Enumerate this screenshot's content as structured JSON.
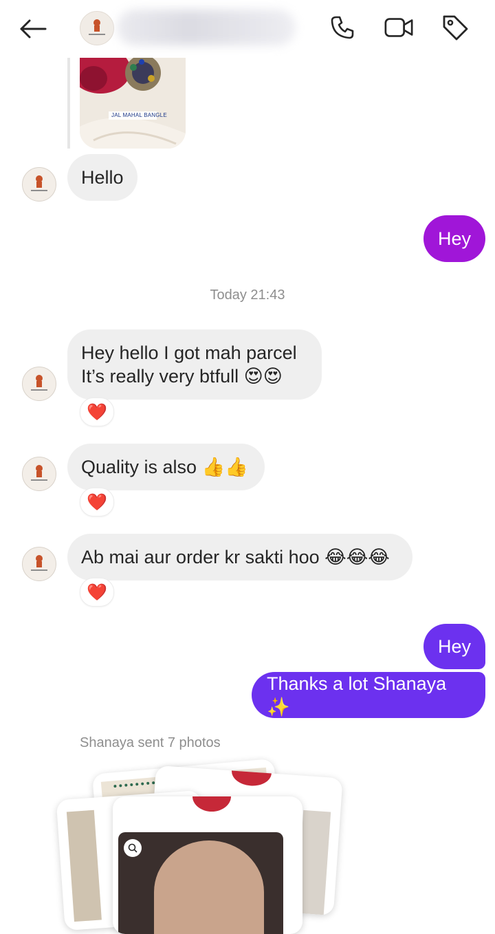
{
  "header": {
    "back_icon": "arrow-left-icon",
    "call_icon": "phone-icon",
    "video_icon": "video-camera-icon",
    "tag_icon": "tag-icon"
  },
  "shared_post": {
    "caption": "JAL MAHAL BANGLE"
  },
  "messages": [
    {
      "side": "in",
      "text": "Hello"
    },
    {
      "side": "out",
      "text": "Hey",
      "color": "#a016d8"
    },
    {
      "side": "in",
      "line1": "Hey hello I got mah parcel",
      "line2": "It’s really very btfull 😍😍",
      "reaction": "❤️"
    },
    {
      "side": "in",
      "text": "Quality is also 👍👍",
      "reaction": "❤️"
    },
    {
      "side": "in",
      "text": "Ab mai aur order kr sakti hoo 😂😂😂",
      "reaction": "❤️"
    },
    {
      "side": "out",
      "text": "Hey",
      "color": "#6c31ef"
    },
    {
      "side": "out",
      "text": "Thanks a lot Shanaya ✨",
      "color": "#6c31ef"
    }
  ],
  "timestamp": "Today 21:43",
  "photos_note": "Shanaya sent 7 photos",
  "colors": {
    "incoming_bubble": "#efefef",
    "outgoing_purple": "#a016d8",
    "outgoing_violet": "#6c31ef",
    "muted_text": "#8e8e8e"
  }
}
